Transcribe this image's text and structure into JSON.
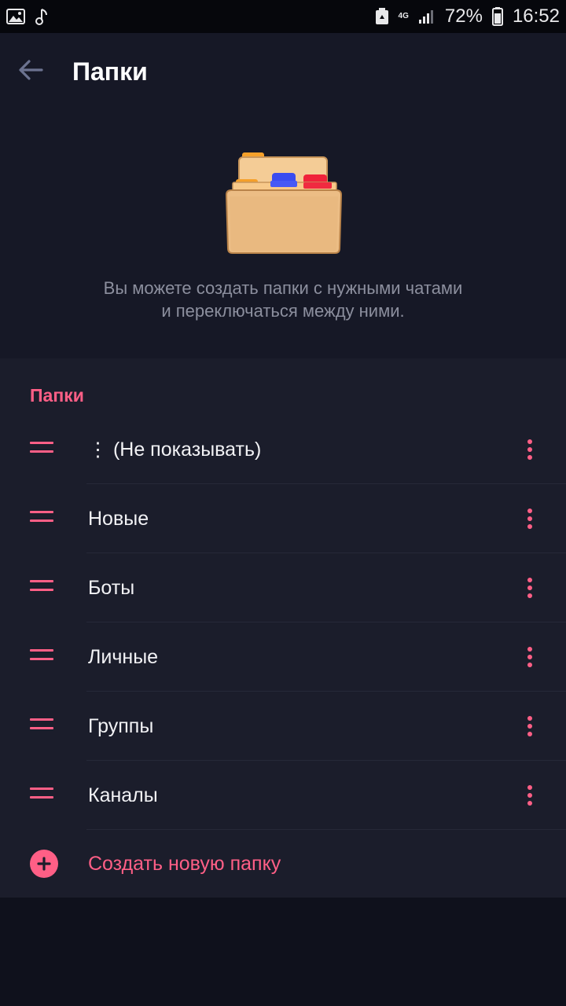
{
  "status_bar": {
    "network": "4G",
    "battery": "72%",
    "time": "16:52",
    "icons": [
      "image-icon",
      "music-note-icon",
      "recycle-icon",
      "network-4g-icon",
      "signal-icon",
      "battery-icon"
    ]
  },
  "header": {
    "back_icon": "arrow-left-icon",
    "title": "Папки"
  },
  "intro": {
    "illustration": "folder-illustration",
    "description_line1": "Вы можете создать папки с нужными чатами",
    "description_line2": "и переключаться между ними."
  },
  "folders": {
    "section_title": "Папки",
    "items": [
      {
        "label": "⋮ (Не показывать)"
      },
      {
        "label": "Новые"
      },
      {
        "label": "Боты"
      },
      {
        "label": "Личные"
      },
      {
        "label": "Группы"
      },
      {
        "label": "Каналы"
      }
    ],
    "create_label": "Создать новую папку"
  },
  "colors": {
    "accent": "#ff5f86",
    "background": "#0f111c",
    "header_bg": "#161826",
    "list_bg": "#1b1d2b"
  }
}
